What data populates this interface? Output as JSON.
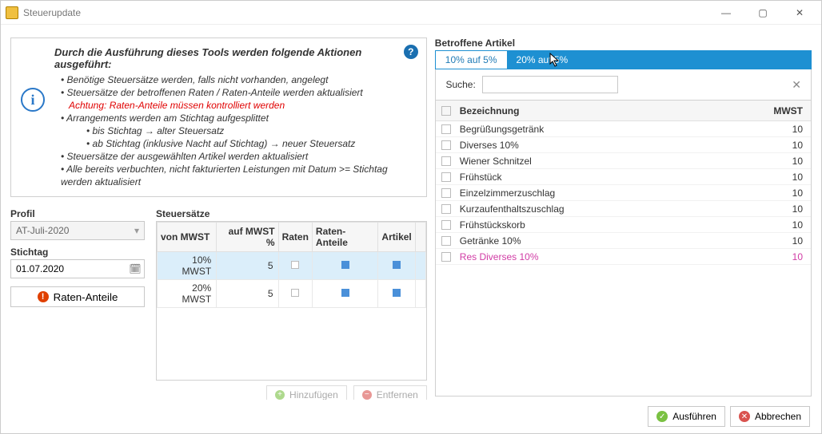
{
  "window": {
    "title": "Steuerupdate"
  },
  "intro": {
    "head": "Durch die Ausführung dieses Tools werden folgende Aktionen ausgeführt:",
    "b1": "Benötige Steuersätze werden, falls nicht vorhanden, angelegt",
    "b2": "Steuersätze der betroffenen Raten / Raten-Anteile werden aktualisiert",
    "warn": "Achtung: Raten-Anteile müssen kontrolliert werden",
    "b3": "Arrangements werden am Stichtag aufgesplittet",
    "b3a": "bis Stichtag → alter Steuersatz",
    "b3b": "ab Stichtag (inklusive Nacht auf Stichtag) → neuer Steuersatz",
    "b4": "Steuersätze der ausgewählten Artikel werden aktualisiert",
    "b5": "Alle bereits verbuchten, nicht fakturierten Leistungen mit Datum >= Stichtag werden aktualisiert"
  },
  "labels": {
    "profil": "Profil",
    "stichtag": "Stichtag",
    "steuersaetze": "Steuersätze",
    "betroffene": "Betroffene Artikel",
    "suche": "Suche:",
    "bezeichnung": "Bezeichnung",
    "mwst": "MWST"
  },
  "profil": {
    "value": "AT-Juli-2020"
  },
  "stichtag": {
    "value": "01.07.2020"
  },
  "raten_btn": "Raten-Anteile",
  "tax_headers": {
    "von": "von MWST",
    "auf": "auf MWST %",
    "raten": "Raten",
    "anteile": "Raten-Anteile",
    "artikel": "Artikel"
  },
  "tax_rows": [
    {
      "von": "10% MWST",
      "auf": "5",
      "raten": false,
      "anteile": true,
      "artikel": true,
      "selected": true
    },
    {
      "von": "20% MWST",
      "auf": "5",
      "raten": false,
      "anteile": true,
      "artikel": true,
      "selected": false
    }
  ],
  "grid_actions": {
    "add": "Hinzufügen",
    "remove": "Entfernen"
  },
  "tabs": [
    {
      "label": "10% auf 5%",
      "active": true
    },
    {
      "label": "20% auf 5%",
      "active": false
    }
  ],
  "articles": [
    {
      "name": "Begrüßungsgetränk",
      "mwst": "10"
    },
    {
      "name": "Diverses 10%",
      "mwst": "10"
    },
    {
      "name": "Wiener Schnitzel",
      "mwst": "10"
    },
    {
      "name": "Frühstück",
      "mwst": "10"
    },
    {
      "name": "Einzelzimmerzuschlag",
      "mwst": "10"
    },
    {
      "name": "Kurzaufenthaltszuschlag",
      "mwst": "10"
    },
    {
      "name": "Frühstückskorb",
      "mwst": "10"
    },
    {
      "name": "Getränke 10%",
      "mwst": "10"
    },
    {
      "name": "Res Diverses 10%",
      "mwst": "10",
      "special": true
    }
  ],
  "footer": {
    "ok": "Ausführen",
    "cancel": "Abbrechen"
  }
}
